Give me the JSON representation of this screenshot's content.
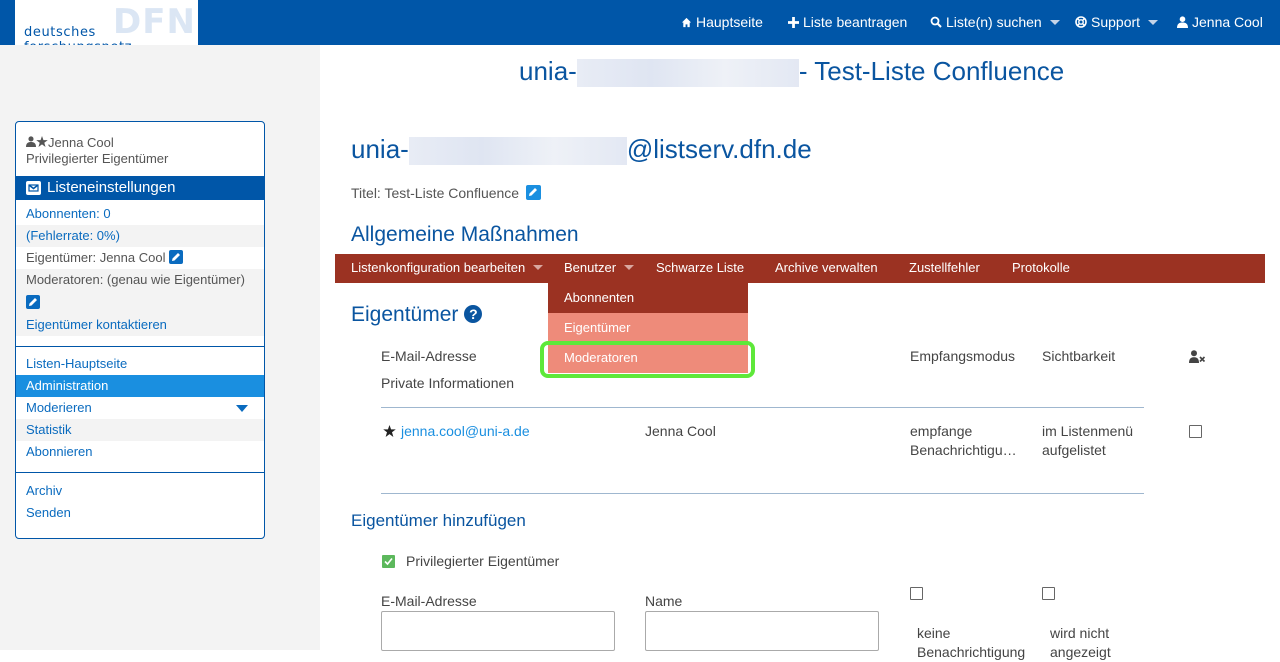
{
  "header": {
    "logo_big": "DFN",
    "logo_small": "deutsches forschungsnetz",
    "nav": {
      "home": "Hauptseite",
      "request_list": "Liste beantragen",
      "search_lists": "Liste(n) suchen",
      "support": "Support",
      "user": "Jenna Cool"
    }
  },
  "sidebar": {
    "user_name": "Jenna Cool",
    "user_role": "Privilegierter Eigentümer",
    "section_title": "Listeneinstellungen",
    "subscribers": "Abonnenten: 0",
    "error_rate": "(Fehlerrate: 0%)",
    "owner": "Eigentümer: Jenna Cool",
    "moderators": "Moderatoren: (genau wie Eigentümer)",
    "contact_owners": "Eigentümer kontaktieren",
    "links": [
      "Listen-Hauptseite",
      "Administration",
      "Moderieren",
      "Statistik",
      "Abonnieren"
    ],
    "links2": [
      "Archiv",
      "Senden"
    ]
  },
  "main": {
    "page_title_prefix": "unia-",
    "page_title_suffix": "- Test-Liste Confluence",
    "address_prefix": "unia-",
    "address_suffix": "@listserv.dfn.de",
    "title_label": "Titel:",
    "title_value": "Test-Liste Confluence",
    "section_general": "Allgemeine Maßnahmen",
    "menu": {
      "edit_config": "Listenkonfiguration bearbeiten",
      "users": "Benutzer",
      "blacklist": "Schwarze Liste",
      "archives": "Archive verwalten",
      "bounces": "Zustellfehler",
      "logs": "Protokolle"
    },
    "dropdown": [
      "Abonnenten",
      "Eigentümer",
      "Moderatoren"
    ],
    "owners_heading": "Eigentümer",
    "table": {
      "col_email": "E-Mail-Adresse",
      "col_private": "Private Informationen",
      "col_reception": "Empfangsmodus",
      "col_visibility": "Sichtbarkeit",
      "row": {
        "email": "jenna.cool@uni-a.de",
        "name": "Jenna Cool",
        "reception": "empfange Benachrichtigu…",
        "visibility": "im Listenmenü aufgelistet"
      }
    },
    "add_owners_heading": "Eigentümer hinzufügen",
    "privileged_owner": "Privilegierter Eigentümer",
    "form": {
      "email_label": "E-Mail-Adresse",
      "name_label": "Name",
      "no_notification": "keine Benachrichtigung",
      "not_shown": "wird nicht angezeigt"
    }
  },
  "colors": {
    "brand_blue": "#0056a8",
    "menu_red": "#9b3222",
    "dropdown_salmon": "#ee8b7a",
    "highlight_green": "#5ee83a"
  }
}
